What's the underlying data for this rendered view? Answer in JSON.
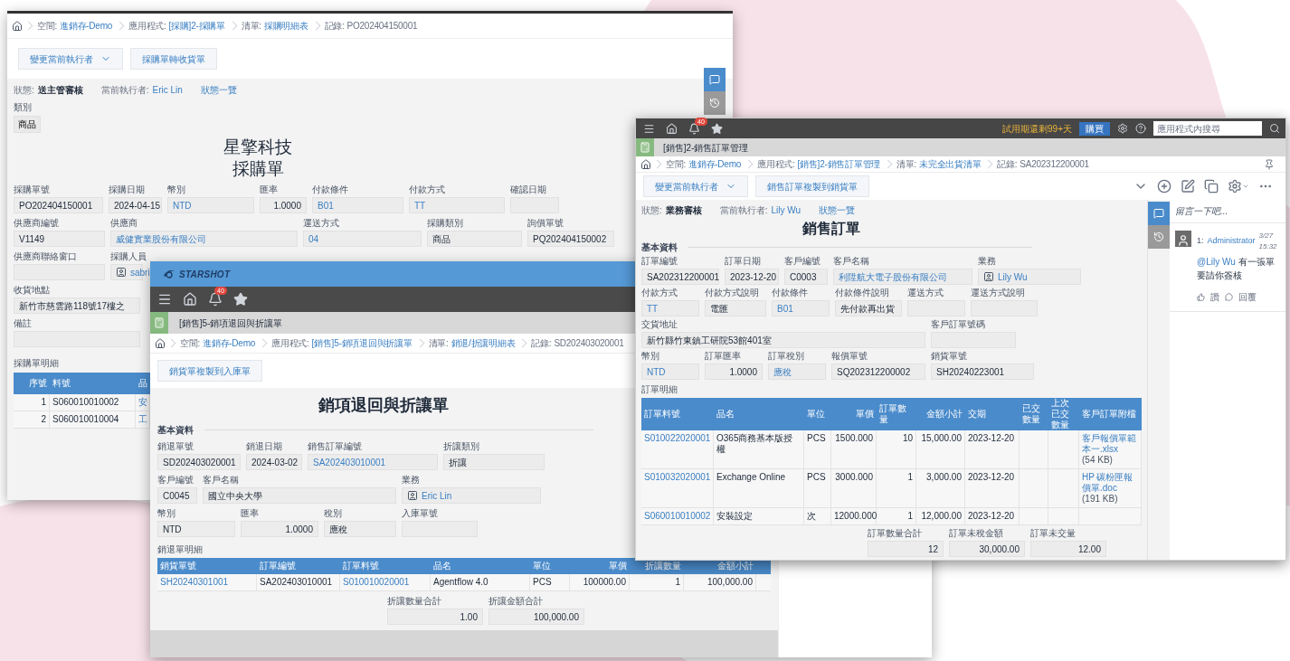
{
  "purchase_window": {
    "breadcrumb": [
      {
        "label": "空間:",
        "value": "進銷存-Demo",
        "kind": "link"
      },
      {
        "label": "應用程式:",
        "value": "[採購]2-採購單",
        "kind": "link"
      },
      {
        "label": "清單:",
        "value": "採購明細表",
        "kind": "link"
      },
      {
        "label": "記錄:",
        "value": "PO202404150001",
        "kind": "text"
      }
    ],
    "buttons": [
      {
        "label": "變更當前執行者",
        "dropdown": true
      },
      {
        "label": "採購單轉收貨單",
        "dropdown": false
      }
    ],
    "status": {
      "state_label": "狀態:",
      "state": "送主管審核",
      "executor_label": "當前執行者:",
      "executor": "Eric Lin",
      "overview": "狀態一覽"
    },
    "category": {
      "label": "類別",
      "value": "商品"
    },
    "title": [
      "星擎科技",
      "採購單"
    ],
    "field_rows": [
      [
        {
          "label": "採購單號",
          "value": "PO202404150001",
          "kind": "text"
        },
        {
          "label": "採購日期",
          "value": "2024-04-15",
          "kind": "text"
        },
        {
          "label": "幣別",
          "value": "NTD",
          "kind": "link"
        },
        {
          "label": "匯率",
          "value": "1.0000",
          "kind": "number"
        },
        {
          "label": "付款條件",
          "value": "B01",
          "kind": "link"
        },
        {
          "label": "付款方式",
          "value": "TT",
          "kind": "link"
        },
        {
          "label": "確認日期",
          "kind": "empty"
        }
      ],
      [
        {
          "label": "供應商編號",
          "value": "V1149",
          "kind": "text"
        },
        {
          "label": "供應商",
          "value": "威健實業股份有限公司",
          "kind": "link"
        },
        {
          "label": "運送方式",
          "value": "04",
          "kind": "link"
        },
        {
          "label": "採購類別",
          "value": "商品",
          "kind": "text"
        },
        {
          "label": "詢價單號",
          "value": "PQ202404150002",
          "kind": "text"
        }
      ],
      [
        {
          "label": "供應商聯絡窗口",
          "kind": "empty"
        },
        {
          "label": "採購人員",
          "value": "sabri",
          "kind": "person"
        }
      ],
      [
        {
          "label": "收貨地點",
          "value": "新竹市慈雲路118號17樓之",
          "kind": "text"
        }
      ],
      [
        {
          "label": "備註",
          "kind": "empty"
        }
      ]
    ],
    "detail": {
      "label": "採購單明細",
      "columns": [
        {
          "label": "序號",
          "kind": "number"
        },
        {
          "label": "料號",
          "kind": "text"
        },
        {
          "label": "品",
          "kind": "link"
        }
      ],
      "rows": [
        [
          "1",
          "S060010010002",
          "安"
        ],
        [
          "2",
          "S060010010004",
          "工"
        ]
      ]
    }
  },
  "return_window": {
    "header": {
      "logo": "STARSHOT",
      "notifications": "40"
    },
    "app_title": "[銷售]5-銷項退回與折讓單",
    "breadcrumb": [
      {
        "label": "空間:",
        "value": "進銷存-Demo",
        "kind": "link"
      },
      {
        "label": "應用程式:",
        "value": "[銷售]5-銷項退回與折讓單",
        "kind": "link"
      },
      {
        "label": "清單:",
        "value": "銷退/折讓明細表",
        "kind": "link"
      },
      {
        "label": "記錄:",
        "value": "SD202403020001",
        "kind": "text"
      }
    ],
    "buttons": [
      {
        "label": "銷貨單複製到入庫單",
        "dropdown": false
      }
    ],
    "title": "銷項退回與折讓單",
    "section": "基本資料",
    "field_rows": [
      [
        {
          "label": "銷退單號",
          "value": "SD202403020001",
          "kind": "text"
        },
        {
          "label": "銷退日期",
          "value": "2024-03-02",
          "kind": "text"
        },
        {
          "label": "銷售訂單編號",
          "value": "SA202403010001",
          "kind": "link"
        },
        {
          "label": "折讓類別",
          "value": "折讓",
          "kind": "text"
        }
      ],
      [
        {
          "label": "客戶編號",
          "value": "C0045",
          "kind": "text"
        },
        {
          "label": "客戶名稱",
          "value": "國立中央大學",
          "kind": "text"
        },
        {
          "label": "業務",
          "value": "Eric Lin",
          "kind": "person"
        }
      ],
      [
        {
          "label": "幣別",
          "value": "NTD",
          "kind": "text"
        },
        {
          "label": "匯率",
          "value": "1.0000",
          "kind": "number"
        },
        {
          "label": "稅別",
          "value": "應稅",
          "kind": "text"
        },
        {
          "label": "入庫單號",
          "kind": "empty"
        }
      ]
    ],
    "detail": {
      "label": "銷退單明細",
      "columns": [
        {
          "label": "銷貨單號",
          "kind": "link"
        },
        {
          "label": "訂單編號",
          "kind": "text"
        },
        {
          "label": "訂單料號",
          "kind": "link"
        },
        {
          "label": "品名",
          "kind": "text"
        },
        {
          "label": "單位",
          "kind": "text"
        },
        {
          "label": "單價",
          "kind": "number"
        },
        {
          "label": "折讓數量",
          "kind": "number"
        },
        {
          "label": "金額小計",
          "kind": "number"
        }
      ],
      "rows": [
        [
          "SH20240301001",
          "SA202403010001",
          "S010010020001",
          "Agentflow 4.0",
          "PCS",
          "100000.00",
          "1",
          "100,000.00"
        ]
      ]
    },
    "totals": [
      {
        "label": "折讓數量合計",
        "value": "1.00",
        "kind": "number"
      },
      {
        "label": "折讓金額合計",
        "value": "100,000.00",
        "kind": "number"
      }
    ]
  },
  "sales_window": {
    "topbar": {
      "notifications": "40",
      "trial": "試用期還剩99+天",
      "buy": "購買",
      "search_placeholder": "應用程式內搜尋"
    },
    "app_title": "[銷售]2-銷售訂單管理",
    "breadcrumb": [
      {
        "label": "空間:",
        "value": "進銷存-Demo",
        "kind": "link"
      },
      {
        "label": "應用程式:",
        "value": "[銷售]2-銷售訂單管理",
        "kind": "link"
      },
      {
        "label": "清單:",
        "value": "未完全出貨清單",
        "kind": "link"
      },
      {
        "label": "記錄:",
        "value": "SA202312200001",
        "kind": "text"
      }
    ],
    "buttons": [
      {
        "label": "變更當前執行者",
        "dropdown": true
      },
      {
        "label": "銷售訂單複製到銷貨單",
        "dropdown": false
      }
    ],
    "status": {
      "state_label": "狀態:",
      "state": "業務審核",
      "executor_label": "當前執行者:",
      "executor": "Lily Wu",
      "overview": "狀態一覽"
    },
    "title": "銷售訂單",
    "section": "基本資料",
    "field_rows": [
      [
        {
          "label": "訂單編號",
          "value": "SA202312200001",
          "kind": "text"
        },
        {
          "label": "訂單日期",
          "value": "2023-12-20",
          "kind": "text"
        },
        {
          "label": "客戶編號",
          "value": "C0003",
          "kind": "text"
        },
        {
          "label": "客戶名稱",
          "value": "利陞航大電子股份有限公司",
          "kind": "link"
        },
        {
          "label": "業務",
          "value": "Lily Wu",
          "kind": "person"
        }
      ],
      [
        {
          "label": "付款方式",
          "value": "TT",
          "kind": "link"
        },
        {
          "label": "付款方式說明",
          "value": "電匯",
          "kind": "text"
        },
        {
          "label": "付款條件",
          "value": "B01",
          "kind": "link"
        },
        {
          "label": "付款條件說明",
          "value": "先付款再出貨",
          "kind": "text"
        },
        {
          "label": "運送方式",
          "kind": "empty"
        },
        {
          "label": "運送方式說明",
          "kind": "empty"
        }
      ],
      [
        {
          "label": "交貨地址",
          "value": "新竹縣竹東鎮工研院53館401室",
          "kind": "text"
        },
        {
          "label": "客戶訂單號碼",
          "kind": "empty"
        }
      ],
      [
        {
          "label": "幣別",
          "value": "NTD",
          "kind": "link"
        },
        {
          "label": "訂單匯率",
          "value": "1.0000",
          "kind": "number"
        },
        {
          "label": "訂單稅別",
          "value": "應稅",
          "kind": "link"
        },
        {
          "label": "報價單號",
          "value": "SQ202312200002",
          "kind": "text"
        },
        {
          "label": "銷貨單號",
          "value": "SH20240223001",
          "kind": "text"
        }
      ]
    ],
    "detail": {
      "label": "訂單明細",
      "columns": [
        {
          "label": "訂單料號",
          "kind": "link"
        },
        {
          "label": "品名",
          "kind": "text"
        },
        {
          "label": "單位",
          "kind": "text"
        },
        {
          "label": "單價",
          "kind": "number"
        },
        {
          "label": "訂單數量",
          "kind": "number"
        },
        {
          "label": "金額小計",
          "kind": "number"
        },
        {
          "label": "交期",
          "kind": "text"
        },
        {
          "label": "已交數量",
          "kind": "number"
        },
        {
          "label": "上次已交數量",
          "kind": "number"
        },
        {
          "label": "客戶訂單附檔",
          "kind": "file"
        }
      ],
      "rows": [
        [
          "S010022020001",
          "O365商務基本版授權",
          "PCS",
          "1500.000",
          "10",
          "15,000.00",
          "2023-12-20",
          null,
          null,
          {
            "name": "客戶報價單範本一.xlsx",
            "size": "(54 KB)"
          }
        ],
        [
          "S010032020001",
          "Exchange Online",
          "PCS",
          "3000.000",
          "1",
          "3,000.00",
          "2023-12-20",
          null,
          null,
          {
            "name": "HP 碳粉匣報價單.doc",
            "size": "(191 KB)"
          }
        ],
        [
          "S060010010002",
          "安裝設定",
          "次",
          "12000.000",
          "1",
          "12,000.00",
          "2023-12-20",
          null,
          null,
          null
        ]
      ]
    },
    "totals": [
      {
        "label": "訂單數量合計",
        "value": "12",
        "kind": "number"
      },
      {
        "label": "訂單未稅金額",
        "value": "30,000.00",
        "kind": "number"
      },
      {
        "label": "訂單未交量",
        "value": "12.00",
        "kind": "number"
      }
    ],
    "comments": {
      "placeholder": "留言一下吧...",
      "items": [
        {
          "index": "1:",
          "author": "Administrator",
          "time": "3/27 15:32",
          "mention": "@Lily Wu",
          "text": "有一張單要請你簽核",
          "like": "讚",
          "reply": "回覆"
        }
      ]
    }
  }
}
